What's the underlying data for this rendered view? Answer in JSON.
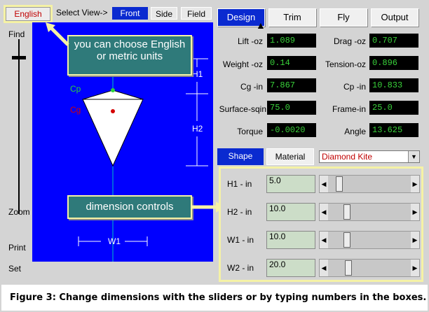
{
  "header": {
    "units_button": "English",
    "select_view_label": "Select View->",
    "view_tabs": [
      "Front",
      "Side",
      "Field"
    ]
  },
  "left_strip": {
    "find_label": "Find",
    "zoom_label": "Zoom",
    "print_label": "Print",
    "set_label": "Set"
  },
  "canvas": {
    "cp_label": "Cp",
    "cg_label": "Cg",
    "h1_label": "H1",
    "h2_label": "H2",
    "w1_label": "W1"
  },
  "top_tabs": [
    "Design",
    "Trim",
    "Fly",
    "Output"
  ],
  "results": [
    {
      "label": "Lift -oz",
      "value": "1.089"
    },
    {
      "label": "Drag -oz",
      "value": "0.707"
    },
    {
      "label": "Weight -oz",
      "value": "0.14"
    },
    {
      "label": "Tension-oz",
      "value": "0.896"
    },
    {
      "label": "Cg -in",
      "value": "7.867"
    },
    {
      "label": "Cp -in",
      "value": "10.833"
    },
    {
      "label": "Surface-sqin",
      "value": "75.0"
    },
    {
      "label": "Frame-in",
      "value": "25.0"
    },
    {
      "label": "Torque",
      "value": "-0.0020"
    },
    {
      "label": "Angle",
      "value": "13.625"
    }
  ],
  "sub_tabs": [
    "Shape",
    "Material"
  ],
  "kite_select": {
    "value": "Diamond Kite"
  },
  "dimensions": [
    {
      "label": "H1 - in",
      "value": "5.0",
      "position": 0.1
    },
    {
      "label": "H2 - in",
      "value": "10.0",
      "position": 0.2
    },
    {
      "label": "W1 - in",
      "value": "10.0",
      "position": 0.2
    },
    {
      "label": "W2 - in",
      "value": "20.0",
      "position": 0.22
    }
  ],
  "callouts": {
    "units": "you can choose English or metric units",
    "dimensions": "dimension controls"
  },
  "caption": "Figure 3: Change dimensions with the sliders or by typing numbers in the boxes.",
  "colors": {
    "canvas_blue": "#0000ff",
    "tab_active": "#0a2ad0",
    "field_text": "#39d23a",
    "callout": "#2f7a7a",
    "highlight": "#f5f2a5"
  }
}
